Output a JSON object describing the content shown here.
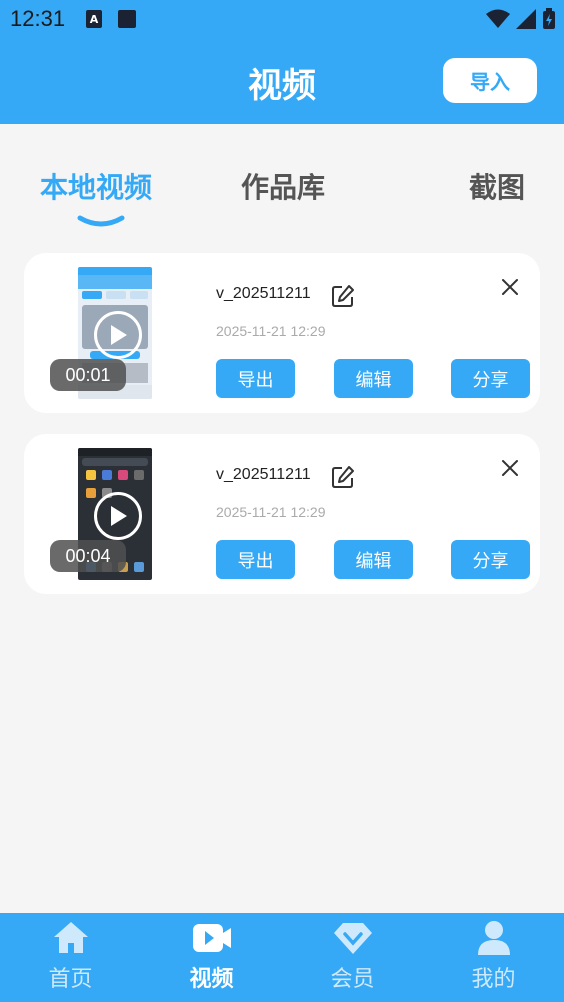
{
  "status_bar": {
    "time": "12:31",
    "notif_letter": "A"
  },
  "header": {
    "title": "视频",
    "import_label": "导入"
  },
  "tabs": [
    {
      "label": "本地视频",
      "active": true
    },
    {
      "label": "作品库",
      "active": false
    },
    {
      "label": "截图",
      "active": false
    }
  ],
  "videos": [
    {
      "filename": "v_202511211",
      "date": "2025-11-21 12:29",
      "duration": "00:01",
      "actions": {
        "export": "导出",
        "edit": "编辑",
        "share": "分享"
      }
    },
    {
      "filename": "v_202511211",
      "date": "2025-11-21 12:29",
      "duration": "00:04",
      "actions": {
        "export": "导出",
        "edit": "编辑",
        "share": "分享"
      }
    }
  ],
  "bottom_nav": [
    {
      "label": "首页",
      "icon": "home-icon",
      "active": false
    },
    {
      "label": "视频",
      "icon": "video-icon",
      "active": true
    },
    {
      "label": "会员",
      "icon": "vip-diamond-icon",
      "active": false
    },
    {
      "label": "我的",
      "icon": "user-icon",
      "active": false
    }
  ],
  "colors": {
    "accent": "#35a9f5",
    "background": "#f5f5f5"
  }
}
